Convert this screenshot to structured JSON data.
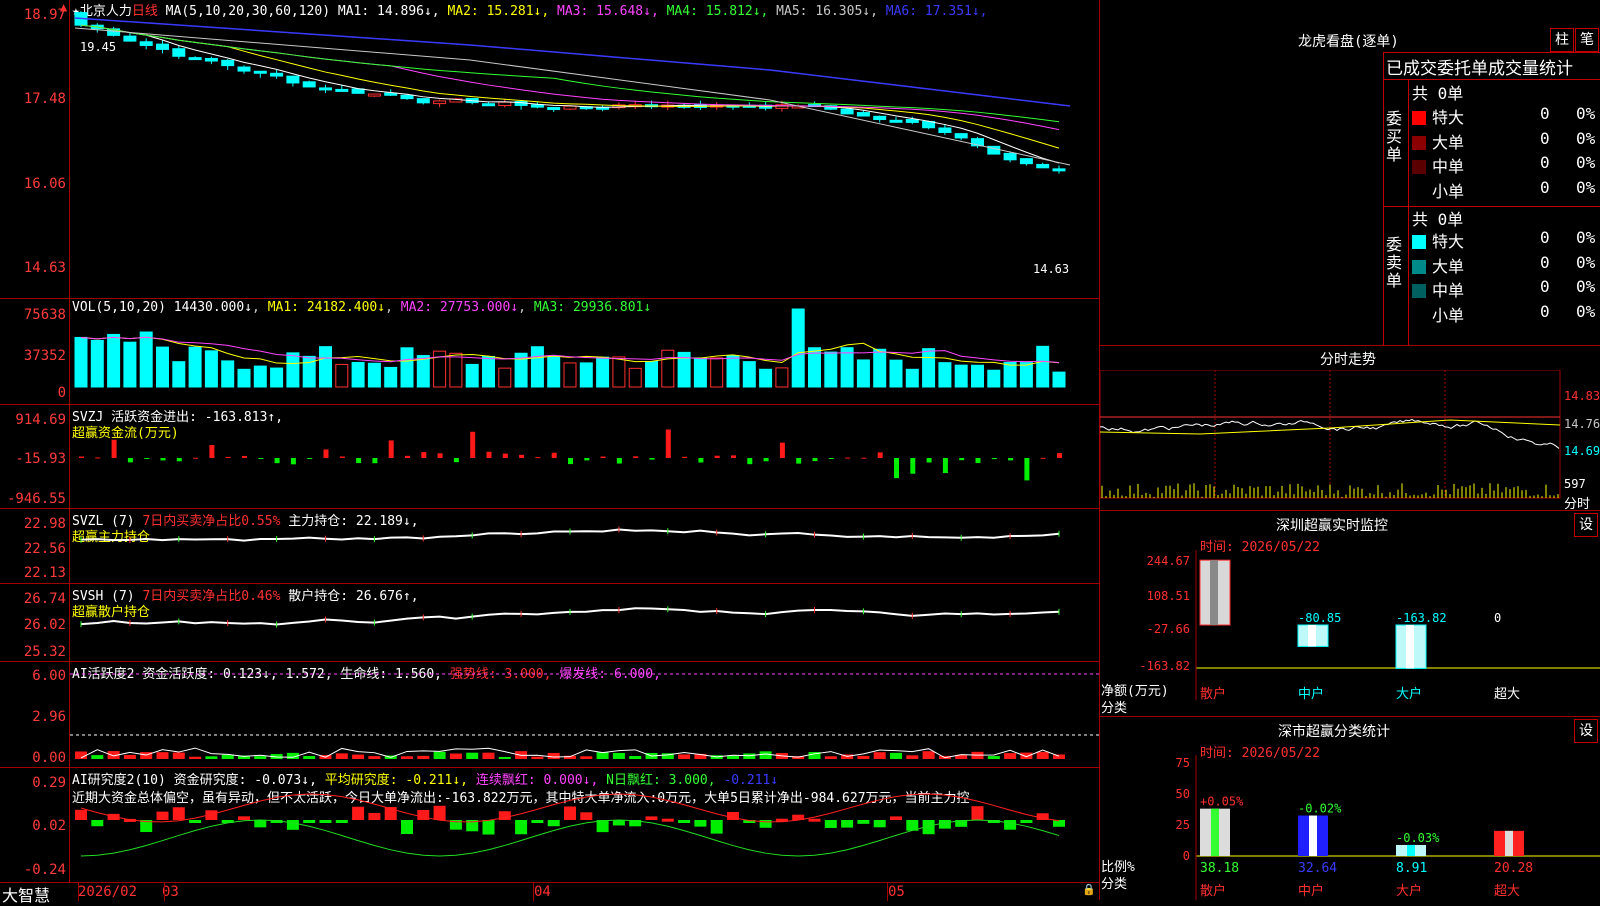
{
  "stock": {
    "name": "★北京人力",
    "period": "日线",
    "ma_spec": "MA(5,10,20,30,60,120)",
    "ma": [
      {
        "label": "MA1:",
        "value": "14.896↓",
        "color": "#ffffff"
      },
      {
        "label": "MA2:",
        "value": "15.281↓",
        "color": "#ffff00"
      },
      {
        "label": "MA3:",
        "value": "15.648↓",
        "color": "#ff44ff"
      },
      {
        "label": "MA4:",
        "value": "15.812↓",
        "color": "#33ff33"
      },
      {
        "label": "MA5:",
        "value": "16.305↓",
        "color": "#c8c8c8"
      },
      {
        "label": "MA6:",
        "value": "17.351↓",
        "color": "#3a3aff"
      }
    ],
    "price_axis": [
      "18.97",
      "17.48",
      "16.06",
      "14.63"
    ],
    "high_mark": "19.45",
    "low_mark": "14.63"
  },
  "vol": {
    "header": "VOL(5,10,20)",
    "vol": "14430.000↓",
    "ma1": "MA1: 24182.400↓",
    "ma2": "MA2: 27753.000↓",
    "ma3": "MA3: 29936.801↓",
    "axis": [
      "75638",
      "37352",
      "0"
    ]
  },
  "svzj": {
    "header": "SVZJ",
    "item": "活跃资金进出: -163.813↑,",
    "sub": "超赢资金流(万元)",
    "axis": [
      "914.69",
      "-15.93",
      "-946.55"
    ]
  },
  "svzl": {
    "header": "SVZL (7)",
    "pct": "7日内买卖净占比0.55%",
    "hold": "主力持仓: 22.189↓,",
    "sub": "超赢主力持仓",
    "axis": [
      "22.98",
      "22.56",
      "22.13"
    ]
  },
  "svsh": {
    "header": "SVSH (7)",
    "pct": "7日内买卖净占比0.46%",
    "hold": "散户持仓: 26.676↑,",
    "sub": "超赢散户持仓",
    "axis": [
      "26.74",
      "26.02",
      "25.32"
    ]
  },
  "ai1": {
    "header": "AI活跃度2",
    "a": "资金活跃度: 0.123↓,",
    "b": "1.572,",
    "c": "生命线: 1.560,",
    "d": "强势线: 3.000,",
    "e": "爆发线: 6.000,",
    "axis": [
      "6.00",
      "2.96",
      "0.00"
    ]
  },
  "ai2": {
    "header": "AI研究度2(10)",
    "a": "资金研究度: -0.073↓,",
    "b": "平均研究度: -0.211↓,",
    "c": "连续飘红: 0.000↓,",
    "d": "N日飘红: 3.000,",
    "e": "-0.211↓",
    "text": "近期大资金总体偏空，虽有异动，但不太活跃，今日大单净流出:-163.822万元，其中特大单净流入:0万元，大单5日累计净出-984.627万元，当前主力控",
    "axis": [
      "0.29",
      "0.02",
      "-0.24"
    ]
  },
  "footer": {
    "brand": "大智慧",
    "dates": [
      "2026/02",
      "03",
      "04",
      "05"
    ]
  },
  "longhu": {
    "title": "龙虎看盘(逐单)",
    "btn1": "柱",
    "btn2": "笔",
    "subtitle": "已成交委托单成交量统计",
    "buy_label": "委买单",
    "sell_label": "委卖单",
    "count": "共 0单",
    "buy": [
      {
        "name": "特大",
        "n": "0",
        "p": "0%",
        "color": "#ff0000"
      },
      {
        "name": "大单",
        "n": "0",
        "p": "0%",
        "color": "#8b0000"
      },
      {
        "name": "中单",
        "n": "0",
        "p": "0%",
        "color": "#5a0000"
      },
      {
        "name": "小单",
        "n": "0",
        "p": "0%",
        "color": "#000000"
      }
    ],
    "sell": [
      {
        "name": "特大",
        "n": "0",
        "p": "0%",
        "color": "#00ffff"
      },
      {
        "name": "大单",
        "n": "0",
        "p": "0%",
        "color": "#008b8b"
      },
      {
        "name": "中单",
        "n": "0",
        "p": "0%",
        "color": "#006060"
      },
      {
        "name": "小单",
        "n": "0",
        "p": "0%",
        "color": "#000000"
      }
    ]
  },
  "fenshi": {
    "title": "分时走势",
    "axis": [
      "14.83",
      "14.76",
      "14.69"
    ],
    "vol": "597",
    "vol_unit": "分时"
  },
  "monitor": {
    "title": "深圳超赢实时监控",
    "btn": "设",
    "time": "时间: 2026/05/22",
    "axis": [
      "244.67",
      "108.51",
      "-27.66",
      "-163.82"
    ],
    "unit": "净额(万元)",
    "cat_label": "分类",
    "categories": [
      "散户",
      "中户",
      "大户",
      "超大"
    ],
    "values": [
      "244.67",
      "-80.85",
      "-163.82",
      "0"
    ]
  },
  "classify": {
    "title": "深市超赢分类统计",
    "btn": "设",
    "time": "时间: 2026/05/22",
    "axis": [
      "75",
      "50",
      "25",
      "0"
    ],
    "unit": "比例%",
    "cat_label": "分类",
    "categories": [
      "散户",
      "中户",
      "大户",
      "超大"
    ],
    "pct": [
      "+0.05%",
      "-0.02%",
      "-0.03%",
      ""
    ],
    "values": [
      "38.18",
      "32.64",
      "8.91",
      "20.28"
    ]
  }
}
